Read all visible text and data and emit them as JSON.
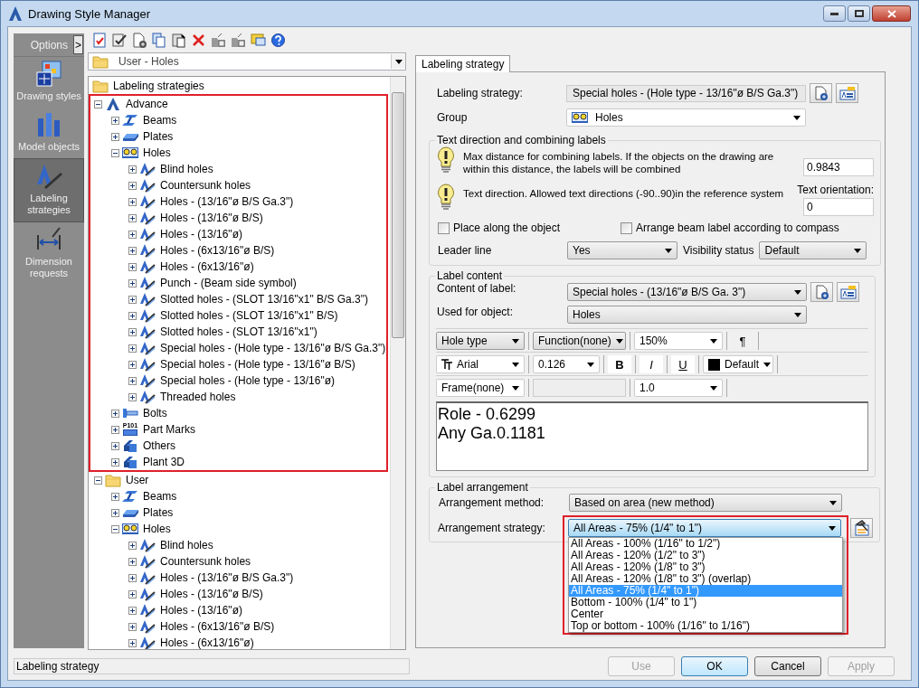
{
  "window": {
    "title": "Drawing Style Manager"
  },
  "sidebar": {
    "options_label": "Options",
    "expand_glyph": ">",
    "items": [
      {
        "label": "Drawing styles",
        "kind": "styles",
        "selected": false
      },
      {
        "label": "Model objects",
        "kind": "objects",
        "selected": false
      },
      {
        "label": "Labeling strategies",
        "kind": "strategies",
        "selected": true
      },
      {
        "label": "Dimension requests",
        "kind": "dimensions",
        "selected": false
      }
    ]
  },
  "explorer": {
    "location": "User - Holes",
    "tree": [
      {
        "label": "Labeling strategies",
        "kind": "folder",
        "children": [
          {
            "label": "Advance",
            "kind": "root",
            "expanded": true,
            "highlighted": true,
            "children": [
              {
                "label": "Beams",
                "kind": "beams",
                "expanded": false
              },
              {
                "label": "Plates",
                "kind": "plates",
                "expanded": false
              },
              {
                "label": "Holes",
                "kind": "holes",
                "expanded": true,
                "children": [
                  {
                    "label": "Blind holes",
                    "kind": "strategy",
                    "expanded": false
                  },
                  {
                    "label": "Countersunk holes",
                    "kind": "strategy",
                    "expanded": false
                  },
                  {
                    "label": "Holes - (13/16\"ø B/S Ga.3\")",
                    "kind": "strategy",
                    "expanded": false
                  },
                  {
                    "label": "Holes - (13/16\"ø B/S)",
                    "kind": "strategy",
                    "expanded": false
                  },
                  {
                    "label": "Holes - (13/16\"ø)",
                    "kind": "strategy",
                    "expanded": false
                  },
                  {
                    "label": "Holes - (6x13/16\"ø B/S)",
                    "kind": "strategy",
                    "expanded": false
                  },
                  {
                    "label": "Holes - (6x13/16\"ø)",
                    "kind": "strategy",
                    "expanded": false
                  },
                  {
                    "label": "Punch - (Beam side symbol)",
                    "kind": "strategy",
                    "expanded": false
                  },
                  {
                    "label": "Slotted holes - (SLOT 13/16\"x1\" B/S Ga.3\")",
                    "kind": "strategy",
                    "expanded": false
                  },
                  {
                    "label": "Slotted holes - (SLOT 13/16\"x1\" B/S)",
                    "kind": "strategy",
                    "expanded": false
                  },
                  {
                    "label": "Slotted holes - (SLOT 13/16\"x1\")",
                    "kind": "strategy",
                    "expanded": false
                  },
                  {
                    "label": "Special holes - (Hole type - 13/16\"ø B/S Ga.3\")",
                    "kind": "strategy",
                    "expanded": false
                  },
                  {
                    "label": "Special holes - (Hole type - 13/16\"ø B/S)",
                    "kind": "strategy",
                    "expanded": false
                  },
                  {
                    "label": "Special holes - (Hole type - 13/16\"ø)",
                    "kind": "strategy",
                    "expanded": false
                  },
                  {
                    "label": "Threaded holes",
                    "kind": "strategy",
                    "expanded": false
                  }
                ]
              },
              {
                "label": "Bolts",
                "kind": "bolts",
                "expanded": false
              },
              {
                "label": "Part Marks",
                "kind": "part-marks",
                "icon_text": "P101",
                "expanded": false
              },
              {
                "label": "Others",
                "kind": "others",
                "expanded": false
              },
              {
                "label": "Plant 3D",
                "kind": "others",
                "expanded": false
              }
            ]
          },
          {
            "label": "User",
            "kind": "folder",
            "expanded": true,
            "children": [
              {
                "label": "Beams",
                "kind": "beams",
                "expanded": false
              },
              {
                "label": "Plates",
                "kind": "plates",
                "expanded": false
              },
              {
                "label": "Holes",
                "kind": "holes",
                "expanded": true,
                "children": [
                  {
                    "label": "Blind holes",
                    "kind": "strategy",
                    "expanded": false
                  },
                  {
                    "label": "Countersunk holes",
                    "kind": "strategy",
                    "expanded": false
                  },
                  {
                    "label": "Holes - (13/16\"ø B/S Ga.3\")",
                    "kind": "strategy",
                    "expanded": false
                  },
                  {
                    "label": "Holes - (13/16\"ø B/S)",
                    "kind": "strategy",
                    "expanded": false
                  },
                  {
                    "label": "Holes - (13/16\"ø)",
                    "kind": "strategy",
                    "expanded": false
                  },
                  {
                    "label": "Holes - (6x13/16\"ø B/S)",
                    "kind": "strategy",
                    "expanded": false
                  },
                  {
                    "label": "Holes - (6x13/16\"ø)",
                    "kind": "strategy",
                    "expanded": false
                  }
                ]
              }
            ]
          }
        ]
      }
    ]
  },
  "tabs": [
    {
      "label": "Labeling strategy",
      "selected": true
    }
  ],
  "strategy": {
    "label": "Labeling strategy:",
    "value": "Special holes - (Hole type - 13/16\"ø B/S Ga.3\")"
  },
  "group": {
    "label": "Group",
    "value": "Holes"
  },
  "text_direction": {
    "title": "Text direction and combining labels",
    "distance_note": "Max distance for combining labels. If the objects on the drawing are within this distance, the labels will be combined",
    "distance": "0.9843",
    "direction_note": "Text direction. Allowed text directions (-90..90)in the reference system",
    "orientation_label": "Text orientation:",
    "orientation": "0",
    "checkboxes": [
      {
        "label": "Place along the object",
        "checked": false
      },
      {
        "label": "Arrange beam label according to compass",
        "checked": false
      }
    ],
    "leader_line": {
      "label": "Leader line",
      "value": "Yes"
    },
    "visibility": {
      "label": "Visibility status",
      "value": "Default"
    }
  },
  "label_content": {
    "title": "Label content",
    "content": {
      "label": "Content of label:",
      "value": "Special holes - (13/16\"ø B/S Ga. 3\")"
    },
    "used_for": {
      "label": "Used for object:",
      "value": "Holes"
    },
    "format_rows": [
      [
        {
          "kind": "combo",
          "value": "Hole type"
        },
        {
          "kind": "combo",
          "value": "Function(none)"
        },
        {
          "kind": "edit",
          "value": "150%"
        },
        {
          "kind": "button",
          "value": "¶"
        }
      ],
      [
        {
          "kind": "font",
          "value": "Arial"
        },
        {
          "kind": "edit",
          "value": "0.126"
        },
        {
          "kind": "bold",
          "value": "B"
        },
        {
          "kind": "italic",
          "value": "I"
        },
        {
          "kind": "underline",
          "value": "U"
        },
        {
          "kind": "color",
          "value": "Default",
          "color": "#000000"
        }
      ],
      [
        {
          "kind": "edit",
          "value": "Frame(none)"
        },
        {
          "kind": "blank"
        },
        {
          "kind": "edit",
          "value": "1.0"
        }
      ]
    ],
    "text_lines": [
      "Role - 0.6299",
      "Any Ga.0.1181"
    ]
  },
  "arrangement": {
    "title": "Label arrangement",
    "method": {
      "label": "Arrangement method:",
      "value": "Based on area (new method)"
    },
    "strategy": {
      "label": "Arrangement strategy:",
      "value": "All Areas - 75% (1/4\" to 1\")",
      "open": true,
      "highlighted": true,
      "options": [
        {
          "label": "All Areas - 100% (1/16\" to 1/2\")",
          "selected": false
        },
        {
          "label": "All Areas - 120% (1/2\" to 3\")",
          "selected": false
        },
        {
          "label": "All Areas - 120% (1/8\" to 3\")",
          "selected": false
        },
        {
          "label": "All Areas - 120% (1/8\" to 3\") (overlap)",
          "selected": false
        },
        {
          "label": "All Areas - 75% (1/4\" to 1\")",
          "selected": true
        },
        {
          "label": "Bottom - 100% (1/4\" to 1\")",
          "selected": false
        },
        {
          "label": "Center",
          "selected": false
        },
        {
          "label": "Top or bottom - 100% (1/16\" to 1/16\")",
          "selected": false
        }
      ]
    }
  },
  "buttons": [
    {
      "label": "Use",
      "disabled": true,
      "default": false
    },
    {
      "label": "OK",
      "disabled": false,
      "default": true
    },
    {
      "label": "Cancel",
      "disabled": false,
      "default": false
    },
    {
      "label": "Apply",
      "disabled": true,
      "default": false
    }
  ],
  "status_bar": "Labeling strategy"
}
